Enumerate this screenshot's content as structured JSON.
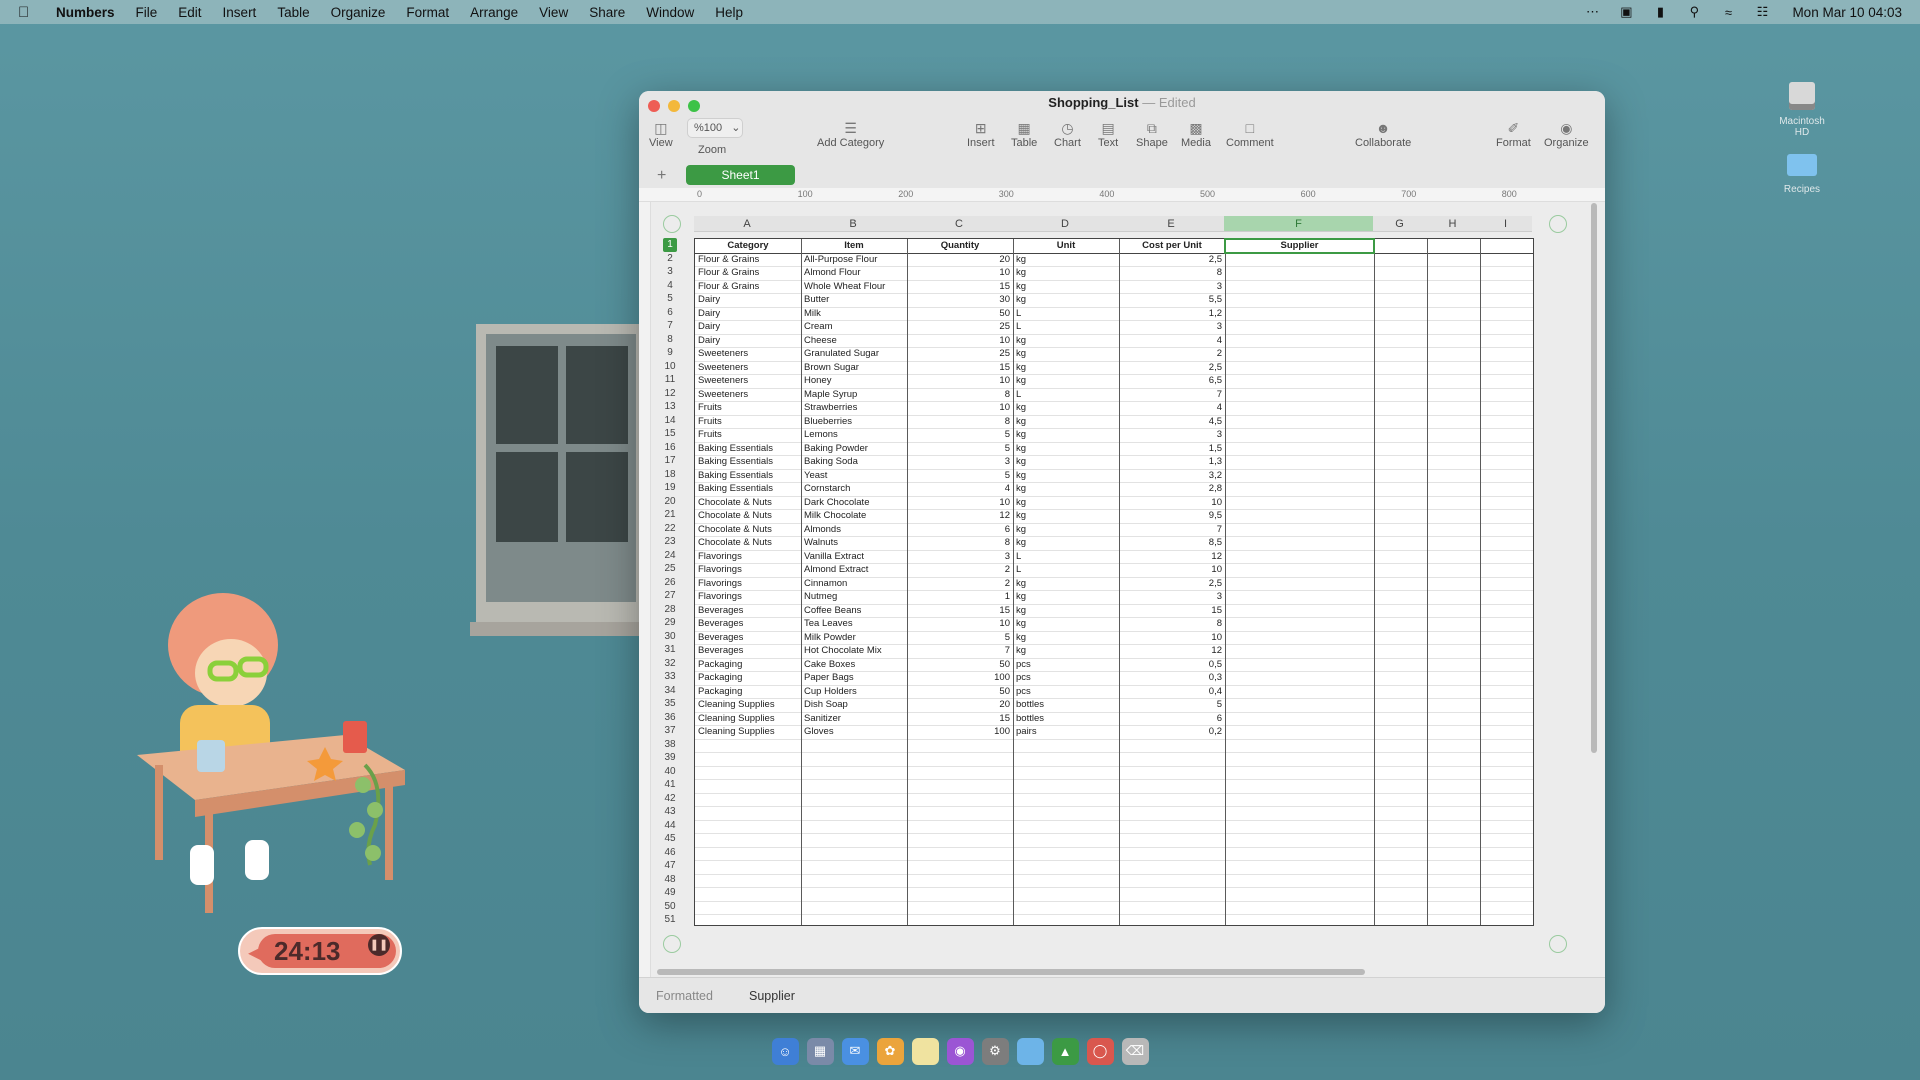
{
  "menubar": {
    "app": "Numbers",
    "items": [
      "File",
      "Edit",
      "Insert",
      "Table",
      "Organize",
      "Format",
      "Arrange",
      "View",
      "Share",
      "Window",
      "Help"
    ],
    "clock": "Mon Mar 10  04:03"
  },
  "desktop": {
    "icons": [
      {
        "label": "Macintosh HD"
      },
      {
        "label": "Recipes"
      }
    ]
  },
  "window": {
    "title": "Shopping_List",
    "status": "— Edited",
    "toolbar": {
      "view": "View",
      "zoom_value": "%100",
      "zoom": "Zoom",
      "add_category": "Add Category",
      "insert": "Insert",
      "table": "Table",
      "chart": "Chart",
      "text": "Text",
      "shape": "Shape",
      "media": "Media",
      "comment": "Comment",
      "collaborate": "Collaborate",
      "format": "Format",
      "organize": "Organize"
    },
    "sheet_tab": "Sheet1",
    "ruler_marks": [
      "0",
      "100",
      "200",
      "300",
      "400",
      "500",
      "600",
      "700",
      "800"
    ],
    "columns": [
      "A",
      "B",
      "C",
      "D",
      "E",
      "F",
      "G",
      "H",
      "I"
    ],
    "selected_column": "F",
    "headers": [
      "Category",
      "Item",
      "Quantity",
      "Unit",
      "Cost per Unit",
      "Supplier"
    ],
    "rows": [
      [
        "Flour & Grains",
        "All-Purpose Flour",
        "20",
        "kg",
        "2,5"
      ],
      [
        "Flour & Grains",
        "Almond Flour",
        "10",
        "kg",
        "8"
      ],
      [
        "Flour & Grains",
        "Whole Wheat Flour",
        "15",
        "kg",
        "3"
      ],
      [
        "Dairy",
        "Butter",
        "30",
        "kg",
        "5,5"
      ],
      [
        "Dairy",
        "Milk",
        "50",
        "L",
        "1,2"
      ],
      [
        "Dairy",
        "Cream",
        "25",
        "L",
        "3"
      ],
      [
        "Dairy",
        "Cheese",
        "10",
        "kg",
        "4"
      ],
      [
        "Sweeteners",
        "Granulated Sugar",
        "25",
        "kg",
        "2"
      ],
      [
        "Sweeteners",
        "Brown Sugar",
        "15",
        "kg",
        "2,5"
      ],
      [
        "Sweeteners",
        "Honey",
        "10",
        "kg",
        "6,5"
      ],
      [
        "Sweeteners",
        "Maple Syrup",
        "8",
        "L",
        "7"
      ],
      [
        "Fruits",
        "Strawberries",
        "10",
        "kg",
        "4"
      ],
      [
        "Fruits",
        "Blueberries",
        "8",
        "kg",
        "4,5"
      ],
      [
        "Fruits",
        "Lemons",
        "5",
        "kg",
        "3"
      ],
      [
        "Baking Essentials",
        "Baking Powder",
        "5",
        "kg",
        "1,5"
      ],
      [
        "Baking Essentials",
        "Baking Soda",
        "3",
        "kg",
        "1,3"
      ],
      [
        "Baking Essentials",
        "Yeast",
        "5",
        "kg",
        "3,2"
      ],
      [
        "Baking Essentials",
        "Cornstarch",
        "4",
        "kg",
        "2,8"
      ],
      [
        "Chocolate & Nuts",
        "Dark Chocolate",
        "10",
        "kg",
        "10"
      ],
      [
        "Chocolate & Nuts",
        "Milk Chocolate",
        "12",
        "kg",
        "9,5"
      ],
      [
        "Chocolate & Nuts",
        "Almonds",
        "6",
        "kg",
        "7"
      ],
      [
        "Chocolate & Nuts",
        "Walnuts",
        "8",
        "kg",
        "8,5"
      ],
      [
        "Flavorings",
        "Vanilla Extract",
        "3",
        "L",
        "12"
      ],
      [
        "Flavorings",
        "Almond Extract",
        "2",
        "L",
        "10"
      ],
      [
        "Flavorings",
        "Cinnamon",
        "2",
        "kg",
        "2,5"
      ],
      [
        "Flavorings",
        "Nutmeg",
        "1",
        "kg",
        "3"
      ],
      [
        "Beverages",
        "Coffee Beans",
        "15",
        "kg",
        "15"
      ],
      [
        "Beverages",
        "Tea Leaves",
        "10",
        "kg",
        "8"
      ],
      [
        "Beverages",
        "Milk Powder",
        "5",
        "kg",
        "10"
      ],
      [
        "Beverages",
        "Hot Chocolate Mix",
        "7",
        "kg",
        "12"
      ],
      [
        "Packaging",
        "Cake Boxes",
        "50",
        "pcs",
        "0,5"
      ],
      [
        "Packaging",
        "Paper Bags",
        "100",
        "pcs",
        "0,3"
      ],
      [
        "Packaging",
        "Cup Holders",
        "50",
        "pcs",
        "0,4"
      ],
      [
        "Cleaning Supplies",
        "Dish Soap",
        "20",
        "bottles",
        "5"
      ],
      [
        "Cleaning Supplies",
        "Sanitizer",
        "15",
        "bottles",
        "6"
      ],
      [
        "Cleaning Supplies",
        "Gloves",
        "100",
        "pairs",
        "0,2"
      ]
    ],
    "total_rows": 51,
    "statusbar": {
      "left": "Formatted",
      "right": "Supplier"
    }
  },
  "timer": {
    "value": "24:13"
  }
}
